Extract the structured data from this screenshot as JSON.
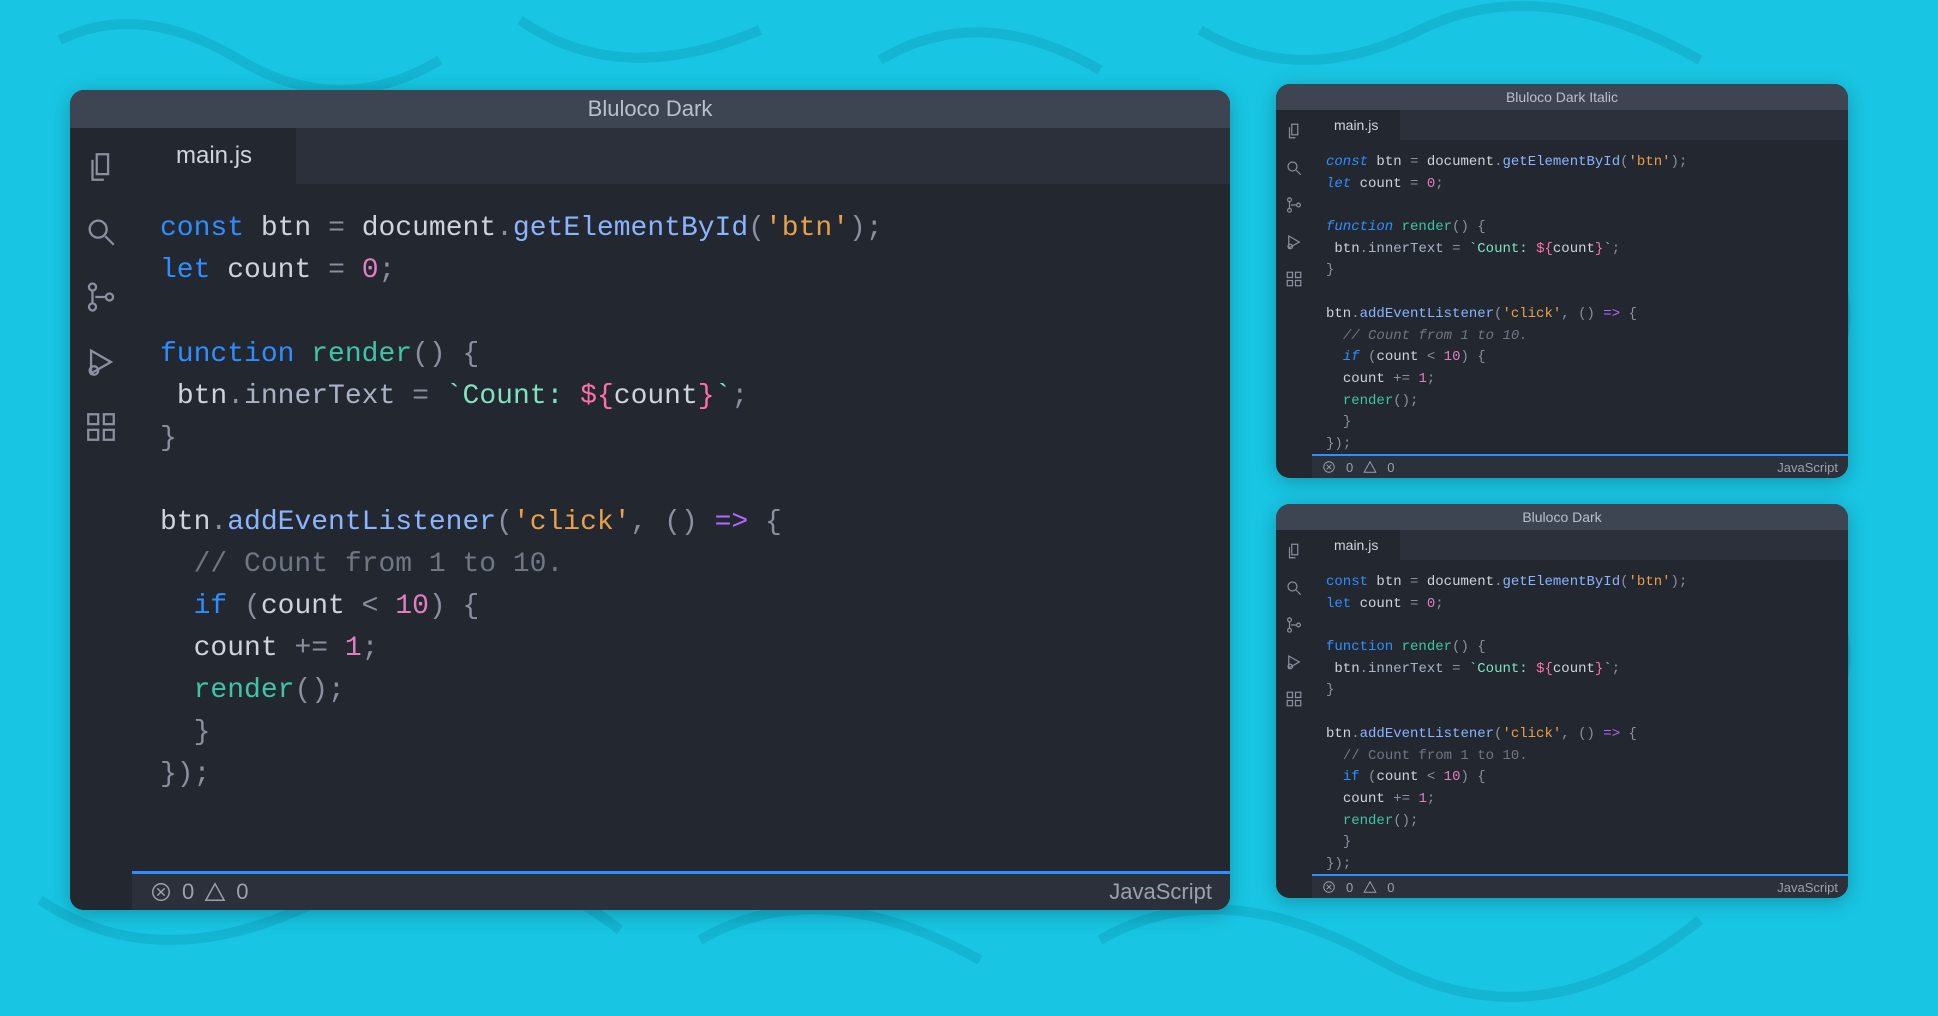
{
  "windows": {
    "large": {
      "title": "Bluloco Dark",
      "italic": false
    },
    "small1": {
      "title": "Bluloco Dark Italic",
      "italic": true
    },
    "small2": {
      "title": "Bluloco Dark",
      "italic": false
    }
  },
  "tab": {
    "filename": "main.js"
  },
  "sidebar_icons": [
    "files-icon",
    "search-icon",
    "source-control-icon",
    "run-debug-icon",
    "extensions-icon"
  ],
  "statusbar": {
    "errors": "0",
    "warnings": "0",
    "language": "JavaScript"
  },
  "code_tokens": [
    [
      {
        "t": "const",
        "c": "kw"
      },
      {
        "t": " "
      },
      {
        "t": "btn",
        "c": "var"
      },
      {
        "t": " "
      },
      {
        "t": "=",
        "c": "pun"
      },
      {
        "t": " "
      },
      {
        "t": "document",
        "c": "var"
      },
      {
        "t": ".",
        "c": "pun"
      },
      {
        "t": "getElementById",
        "c": "prop"
      },
      {
        "t": "(",
        "c": "pun"
      },
      {
        "t": "'btn'",
        "c": "str"
      },
      {
        "t": ")",
        "c": "pun"
      },
      {
        "t": ";",
        "c": "pun"
      }
    ],
    [
      {
        "t": "let",
        "c": "kw"
      },
      {
        "t": " "
      },
      {
        "t": "count",
        "c": "var"
      },
      {
        "t": " "
      },
      {
        "t": "=",
        "c": "pun"
      },
      {
        "t": " "
      },
      {
        "t": "0",
        "c": "num"
      },
      {
        "t": ";",
        "c": "pun"
      }
    ],
    [],
    [
      {
        "t": "function",
        "c": "kw"
      },
      {
        "t": " "
      },
      {
        "t": "render",
        "c": "fn"
      },
      {
        "t": "()",
        "c": "pun"
      },
      {
        "t": " "
      },
      {
        "t": "{",
        "c": "pun"
      }
    ],
    [
      {
        "t": " "
      },
      {
        "t": "btn",
        "c": "var"
      },
      {
        "t": ".",
        "c": "pun"
      },
      {
        "t": "innerText",
        "c": "prop2"
      },
      {
        "t": " "
      },
      {
        "t": "=",
        "c": "pun"
      },
      {
        "t": " "
      },
      {
        "t": "`",
        "c": "tmpl"
      },
      {
        "t": "Count: ",
        "c": "tmpl"
      },
      {
        "t": "${",
        "c": "delim"
      },
      {
        "t": "count",
        "c": "var"
      },
      {
        "t": "}",
        "c": "delim"
      },
      {
        "t": "`",
        "c": "tmpl"
      },
      {
        "t": ";",
        "c": "pun"
      }
    ],
    [
      {
        "t": "}",
        "c": "pun"
      }
    ],
    [],
    [
      {
        "t": "btn",
        "c": "var"
      },
      {
        "t": ".",
        "c": "pun"
      },
      {
        "t": "addEventListener",
        "c": "prop"
      },
      {
        "t": "(",
        "c": "pun"
      },
      {
        "t": "'click'",
        "c": "str"
      },
      {
        "t": ",",
        "c": "pun"
      },
      {
        "t": " "
      },
      {
        "t": "()",
        "c": "pun"
      },
      {
        "t": " "
      },
      {
        "t": "=>",
        "c": "kw2"
      },
      {
        "t": " "
      },
      {
        "t": "{",
        "c": "pun"
      }
    ],
    [
      {
        "t": "  "
      },
      {
        "t": "// Count from 1 to 10.",
        "c": "cmt"
      }
    ],
    [
      {
        "t": "  "
      },
      {
        "t": "if",
        "c": "kw"
      },
      {
        "t": " "
      },
      {
        "t": "(",
        "c": "pun"
      },
      {
        "t": "count",
        "c": "var"
      },
      {
        "t": " "
      },
      {
        "t": "<",
        "c": "pun"
      },
      {
        "t": " "
      },
      {
        "t": "10",
        "c": "num"
      },
      {
        "t": ")",
        "c": "pun"
      },
      {
        "t": " "
      },
      {
        "t": "{",
        "c": "pun"
      }
    ],
    [
      {
        "t": "  "
      },
      {
        "t": "count",
        "c": "var"
      },
      {
        "t": " "
      },
      {
        "t": "+=",
        "c": "pun"
      },
      {
        "t": " "
      },
      {
        "t": "1",
        "c": "num"
      },
      {
        "t": ";",
        "c": "pun"
      }
    ],
    [
      {
        "t": "  "
      },
      {
        "t": "render",
        "c": "fn"
      },
      {
        "t": "()",
        "c": "pun"
      },
      {
        "t": ";",
        "c": "pun"
      }
    ],
    [
      {
        "t": "  "
      },
      {
        "t": "}",
        "c": "pun"
      }
    ],
    [
      {
        "t": "})",
        "c": "pun"
      },
      {
        "t": ";",
        "c": "pun"
      }
    ]
  ]
}
